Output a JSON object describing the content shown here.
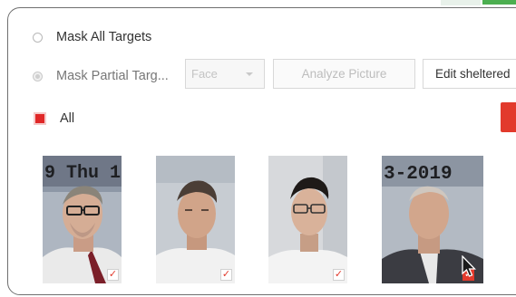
{
  "options": {
    "mask_all_label": "Mask All  Targets",
    "mask_partial_label": "Mask Partial  Targ...",
    "target_type_value": "Face",
    "analyze_label": "Analyze Picture",
    "edit_label": "Edit sheltered",
    "all_label": "All"
  },
  "thumbnails": [
    {
      "overlay": "9 Thu 1",
      "checked": true
    },
    {
      "overlay": "",
      "checked": true
    },
    {
      "overlay": "",
      "checked": true
    },
    {
      "overlay": "3-2019 ",
      "checked": true
    }
  ],
  "colors": {
    "accent_red": "#e23a2c",
    "top_green": "#4caf50"
  }
}
